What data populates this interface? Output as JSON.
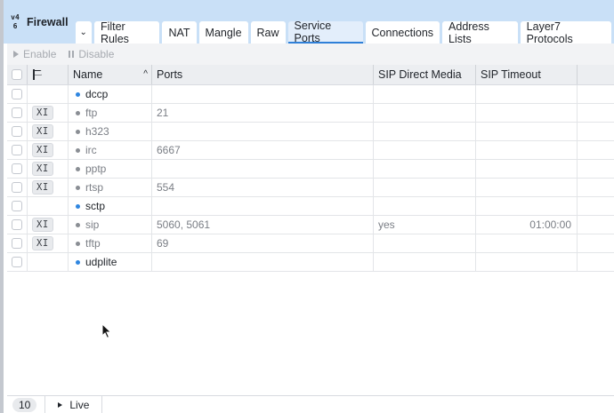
{
  "brand": {
    "title": "Firewall",
    "logo_top": "v4",
    "logo_bottom": "6"
  },
  "tabs": [
    {
      "label": "Filter Rules",
      "active": false
    },
    {
      "label": "NAT",
      "active": false
    },
    {
      "label": "Mangle",
      "active": false
    },
    {
      "label": "Raw",
      "active": false
    },
    {
      "label": "Service Ports",
      "active": true
    },
    {
      "label": "Connections",
      "active": false
    },
    {
      "label": "Address Lists",
      "active": false
    },
    {
      "label": "Layer7 Protocols",
      "active": false
    }
  ],
  "toolbar": {
    "enable_label": "Enable",
    "disable_label": "Disable"
  },
  "table": {
    "columns": {
      "name": "Name",
      "ports": "Ports",
      "sip_direct_media": "SIP Direct Media",
      "sip_timeout": "SIP Timeout"
    },
    "rows": [
      {
        "flag": "",
        "name": "dccp",
        "enabled": true,
        "ports": "",
        "sip_direct_media": "",
        "sip_timeout": ""
      },
      {
        "flag": "XI",
        "name": "ftp",
        "enabled": false,
        "ports": "21",
        "sip_direct_media": "",
        "sip_timeout": ""
      },
      {
        "flag": "XI",
        "name": "h323",
        "enabled": false,
        "ports": "",
        "sip_direct_media": "",
        "sip_timeout": ""
      },
      {
        "flag": "XI",
        "name": "irc",
        "enabled": false,
        "ports": "6667",
        "sip_direct_media": "",
        "sip_timeout": ""
      },
      {
        "flag": "XI",
        "name": "pptp",
        "enabled": false,
        "ports": "",
        "sip_direct_media": "",
        "sip_timeout": ""
      },
      {
        "flag": "XI",
        "name": "rtsp",
        "enabled": false,
        "ports": "554",
        "sip_direct_media": "",
        "sip_timeout": ""
      },
      {
        "flag": "",
        "name": "sctp",
        "enabled": true,
        "ports": "",
        "sip_direct_media": "",
        "sip_timeout": ""
      },
      {
        "flag": "XI",
        "name": "sip",
        "enabled": false,
        "ports": "5060, 5061",
        "sip_direct_media": "yes",
        "sip_timeout": "01:00:00"
      },
      {
        "flag": "XI",
        "name": "tftp",
        "enabled": false,
        "ports": "69",
        "sip_direct_media": "",
        "sip_timeout": ""
      },
      {
        "flag": "",
        "name": "udplite",
        "enabled": true,
        "ports": "",
        "sip_direct_media": "",
        "sip_timeout": ""
      }
    ]
  },
  "footer": {
    "count": "10",
    "live_label": "Live"
  },
  "colors": {
    "accent": "#2f80d8",
    "tabbar_bg": "#c9e0f7",
    "enabled_dot": "#2f86e0",
    "disabled_dot": "#8a8e94"
  }
}
